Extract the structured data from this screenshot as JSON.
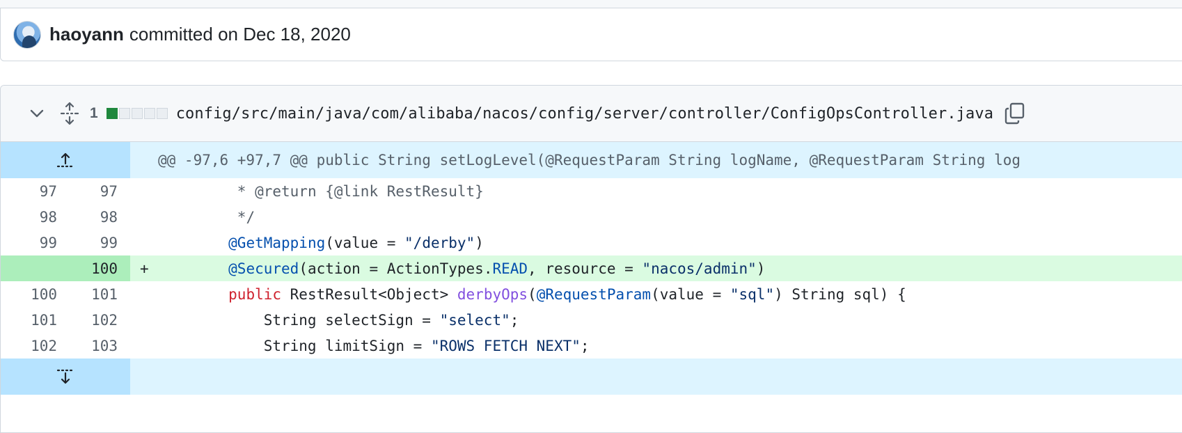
{
  "commit": {
    "author": "haoyann",
    "text": "committed on Dec 18, 2020"
  },
  "file": {
    "change_count": "1",
    "diffstat": [
      "add",
      "neutral",
      "neutral",
      "neutral",
      "neutral"
    ],
    "path": "config/src/main/java/com/alibaba/nacos/config/server/controller/ConfigOpsController.java"
  },
  "hunk": {
    "header": "@@ -97,6 +97,7 @@ public String setLogLevel(@RequestParam String logName, @RequestParam String log"
  },
  "lines": [
    {
      "old": "97",
      "new": "97",
      "marker": "",
      "type": "context"
    },
    {
      "old": "98",
      "new": "98",
      "marker": "",
      "type": "context"
    },
    {
      "old": "99",
      "new": "99",
      "marker": "",
      "type": "context"
    },
    {
      "old": "",
      "new": "100",
      "marker": "+",
      "type": "add"
    },
    {
      "old": "100",
      "new": "101",
      "marker": "",
      "type": "context"
    },
    {
      "old": "101",
      "new": "102",
      "marker": "",
      "type": "context"
    },
    {
      "old": "102",
      "new": "103",
      "marker": "",
      "type": "context"
    }
  ],
  "code": {
    "l0": " * @return {@link RestResult}",
    "l1": " */",
    "l2_ann": "@GetMapping",
    "l2_a": "(value = ",
    "l2_str": "\"/derby\"",
    "l2_b": ")",
    "l3_ann": "@Secured",
    "l3_a": "(action = ActionTypes.",
    "l3_const": "READ",
    "l3_b": ", resource = ",
    "l3_str": "\"nacos/admin\"",
    "l3_c": ")",
    "l4_kw": "public",
    "l4_a": " RestResult<Object> ",
    "l4_fn": "derbyOps",
    "l4_b": "(",
    "l4_ann": "@RequestParam",
    "l4_c": "(value = ",
    "l4_str": "\"sql\"",
    "l4_d": ") String sql) {",
    "l5_a": "String selectSign = ",
    "l5_str": "\"select\"",
    "l5_b": ";",
    "l6_a": "String limitSign = ",
    "l6_str": "\"ROWS FETCH NEXT\"",
    "l6_b": ";"
  },
  "colors": {
    "addition_bg": "#dafbe1",
    "addition_gutter": "#aceebb",
    "hunk_bg": "#ddf4ff",
    "hunk_gutter": "#b6e3ff",
    "diffstat_add": "#1f883d"
  },
  "icons": {
    "collapse": "chevron-down-icon",
    "expand_all": "unfold-icon",
    "copy": "copy-icon",
    "expand_up": "fold-up-icon",
    "expand_down": "fold-down-icon"
  }
}
